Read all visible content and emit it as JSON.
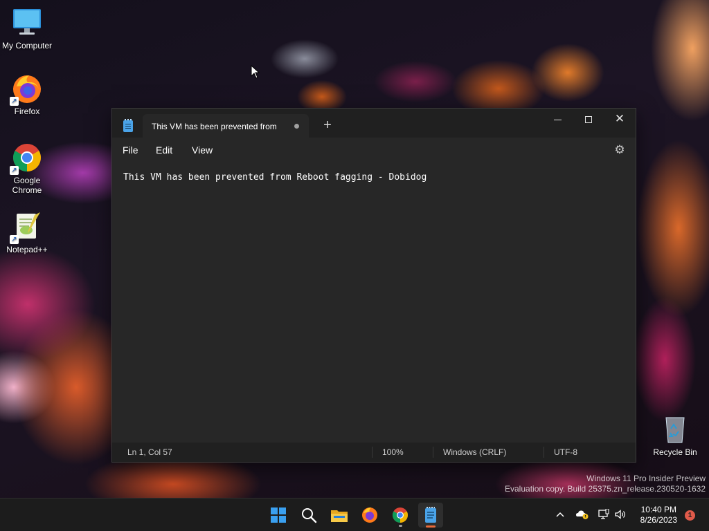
{
  "desktop": {
    "icons": [
      {
        "label": "My Computer",
        "icon": "monitor-icon"
      },
      {
        "label": "Firefox",
        "icon": "firefox-icon"
      },
      {
        "label": "Google Chrome",
        "icon": "chrome-icon"
      },
      {
        "label": "Notepad++",
        "icon": "notepadpp-icon"
      },
      {
        "label": "Recycle Bin",
        "icon": "recycle-bin-icon"
      }
    ]
  },
  "notepad": {
    "tab_title": "This VM has been prevented from",
    "tab_unsaved_indicator": "●",
    "new_tab_label": "+",
    "menu": [
      "File",
      "Edit",
      "View"
    ],
    "content": "This VM has been prevented from Reboot fagging - Dobidog",
    "status": {
      "position": "Ln 1, Col 57",
      "zoom": "100%",
      "line_ending": "Windows (CRLF)",
      "encoding": "UTF-8"
    }
  },
  "watermark": {
    "line1": "Windows 11 Pro Insider Preview",
    "line2": "Evaluation copy. Build 25375.zn_release.230520-1632"
  },
  "taskbar": {
    "apps": [
      "start-icon",
      "search-icon",
      "file-explorer-icon",
      "firefox-icon",
      "chrome-icon",
      "notepad-icon"
    ],
    "time": "10:40 PM",
    "date": "8/26/2023",
    "notification_count": "1",
    "colors": {
      "accent": "#e86a3a",
      "notification": "#e05a4a"
    }
  }
}
